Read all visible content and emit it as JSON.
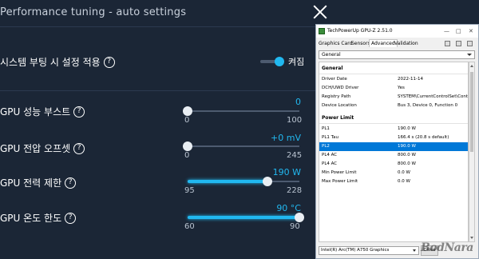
{
  "perf": {
    "title": "Performance tuning - auto settings",
    "close_glyph": "close-icon",
    "boot_apply": {
      "label": "시스템 부팅 시 설정 적용",
      "state_text": "켜짐",
      "on": true
    },
    "sliders": [
      {
        "label": "GPU 성능 부스트",
        "value_text": "0",
        "value": 0,
        "min": 0,
        "max": 100,
        "min_text": "0",
        "max_text": "100"
      },
      {
        "label": "GPU 전압 오프셋",
        "value_text": "+0 mV",
        "value": 0,
        "min": 0,
        "max": 245,
        "min_text": "0",
        "max_text": "245"
      },
      {
        "label": "GPU 전력 제한",
        "value_text": "190 W",
        "value": 190,
        "min": 95,
        "max": 228,
        "min_text": "95",
        "max_text": "228"
      },
      {
        "label": "GPU 온도 한도",
        "value_text": "90 °C",
        "value": 90,
        "min": 60,
        "max": 90,
        "min_text": "60",
        "max_text": "90"
      }
    ],
    "accent": "#21b8f0"
  },
  "gpuz": {
    "title": "TechPowerUp GPU-Z 2.51.0",
    "window_buttons": {
      "min": "—",
      "max": "□",
      "close": "✕"
    },
    "tabs": [
      "Graphics Card",
      "Sensors",
      "Advanced",
      "Validation"
    ],
    "active_tab": "Advanced",
    "category": "General",
    "sections": [
      {
        "heading": "General",
        "rows": [
          {
            "key": "Driver Date",
            "value": "2022-11-14"
          },
          {
            "key": "DCH/UWD Driver",
            "value": "Yes"
          },
          {
            "key": "Registry Path",
            "value": "SYSTEM\\CurrentControlSet\\Control\\"
          },
          {
            "key": "Device Location",
            "value": "Bus 3, Device 0, Function 0"
          }
        ]
      },
      {
        "heading": "Power Limit",
        "rows": [
          {
            "key": "PL1",
            "value": "190.0 W"
          },
          {
            "key": "PL1 Tau",
            "value": "166.4 s (20.8 s default)"
          },
          {
            "key": "PL2",
            "value": "190.0 W",
            "selected": true
          },
          {
            "key": "PL4 AC",
            "value": "800.0 W"
          },
          {
            "key": "PL4 AC",
            "value": "800.0 W"
          },
          {
            "key": "Min Power Limit",
            "value": "0.0 W"
          },
          {
            "key": "Max Power Limit",
            "value": "0.0 W"
          }
        ]
      }
    ],
    "gpu_select": "Intel(R) Arc(TM) A750 Graphics",
    "close_label": "Close"
  },
  "watermark": "BodNara"
}
